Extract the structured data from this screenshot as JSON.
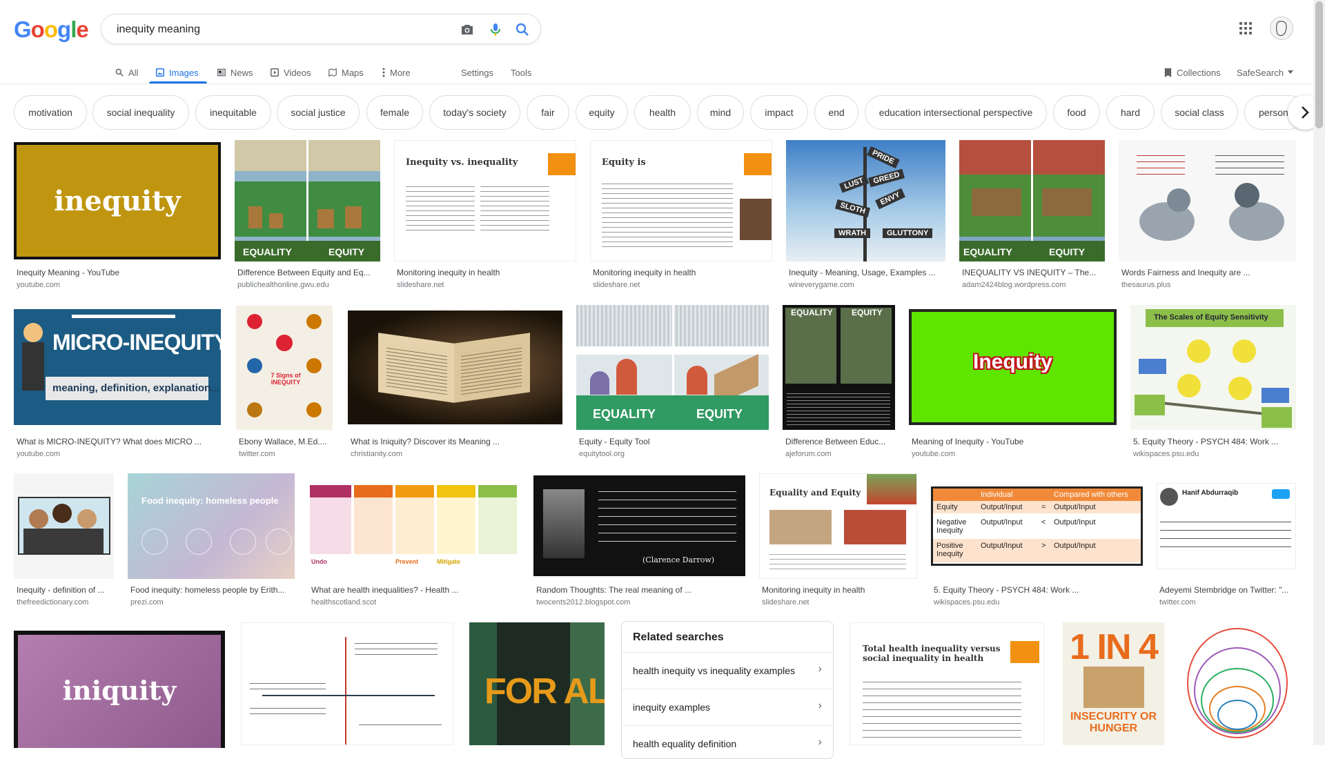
{
  "logo": {
    "letters": [
      "G",
      "o",
      "o",
      "g",
      "l",
      "e"
    ],
    "colors": [
      "#4285f4",
      "#ea4335",
      "#fbbc05",
      "#4285f4",
      "#34a853",
      "#ea4335"
    ]
  },
  "search": {
    "query": "inequity meaning"
  },
  "nav": {
    "all": "All",
    "images": "Images",
    "news": "News",
    "videos": "Videos",
    "maps": "Maps",
    "more": "More",
    "settings": "Settings",
    "tools": "Tools",
    "collections": "Collections",
    "safesearch": "SafeSearch"
  },
  "chips": [
    "motivation",
    "social inequality",
    "inequitable",
    "social justice",
    "female",
    "today's society",
    "fair",
    "equity",
    "health",
    "mind",
    "impact",
    "end",
    "education intersectional perspective",
    "food",
    "hard",
    "social class",
    "person"
  ],
  "results": [
    {
      "title": "Inequity Meaning - YouTube",
      "source": "youtube.com"
    },
    {
      "title": "Difference Between Equity and Eq...",
      "source": "publichealthonline.gwu.edu"
    },
    {
      "title": "Monitoring inequity in health",
      "source": "slideshare.net"
    },
    {
      "title": "Monitoring inequity in health",
      "source": "slideshare.net"
    },
    {
      "title": "Inequity - Meaning, Usage, Examples ...",
      "source": "wineverygame.com"
    },
    {
      "title": "INEQUALITY VS INEQUITY – The...",
      "source": "adam2424blog.wordpress.com"
    },
    {
      "title": "Words Fairness and Inequity are ...",
      "source": "thesaurus.plus"
    },
    {
      "title": "What is MICRO-INEQUITY? What does MICRO ...",
      "source": "youtube.com"
    },
    {
      "title": "Ebony Wallace, M.Ed....",
      "source": "twitter.com"
    },
    {
      "title": "What is Iniquity? Discover its Meaning ...",
      "source": "christianity.com"
    },
    {
      "title": "Equity - Equity Tool",
      "source": "equitytool.org"
    },
    {
      "title": "Difference Between Educ...",
      "source": "ajeforum.com"
    },
    {
      "title": "Meaning of Inequity - YouTube",
      "source": "youtube.com"
    },
    {
      "title": "5. Equity Theory - PSYCH 484: Work ...",
      "source": "wikispaces.psu.edu"
    },
    {
      "title": "Inequity - definition of ...",
      "source": "thefreedictionary.com"
    },
    {
      "title": "Food inequity: homeless people by Erith...",
      "source": "prezi.com"
    },
    {
      "title": "What are health inequalities? - Health ...",
      "source": "healthscotland.scot"
    },
    {
      "title": "Random Thoughts: The real meaning of ...",
      "source": "twocents2012.blogspot.com"
    },
    {
      "title": "Monitoring inequity in health",
      "source": "slideshare.net"
    },
    {
      "title": "5. Equity Theory - PSYCH 484: Work ...",
      "source": "wikispaces.psu.edu"
    },
    {
      "title": "Adeyemi Stembridge on Twitter: \"...",
      "source": "twitter.com"
    }
  ],
  "thumb_text": {
    "inequity": "inequity",
    "equality": "EQUALITY",
    "equity": "EQUITY",
    "ineq_vs": "Inequity vs. inequality",
    "equity_is": "Equity is",
    "micro": "MICRO-INEQUITY",
    "micro_sub": "meaning, definition, explanation...",
    "seven_signs": "7 Signs of INEQUITY",
    "inequity_green": "Inequity",
    "scales": "The Scales of Equity Sensitivity",
    "food_inequity": "Food inequity: homeless people",
    "equality_and_equity": "Equality and Equity",
    "individual": "Individual",
    "compared": "Compared with others",
    "eq_row": [
      "Equity",
      "Output/Input",
      "=",
      "Output/Input"
    ],
    "neg_row": [
      "Negative Inequity",
      "Output/Input",
      "<",
      "Output/Input"
    ],
    "pos_row": [
      "Positive Inequity",
      "Output/Input",
      ">",
      "Output/Input"
    ],
    "hanif": "Hanif Abdurraqib",
    "iniquity": "iniquity",
    "total_health": "Total health inequality versus social inequality in health",
    "one_in_four": "1 IN 4",
    "insecurity": "INSECURITY OR HUNGER",
    "for_all": "FOR ALL",
    "quote": "(Clarence Darrow)",
    "wrath": "WRATH",
    "gluttony": "GLUTTONY",
    "pride": "PRIDE",
    "greed": "GREED",
    "lust": "LUST",
    "envy": "ENVY",
    "sloth": "SLOTH",
    "undo": "Undo",
    "prevent": "Prevent",
    "mitigate": "Mitigate"
  },
  "related": {
    "heading": "Related searches",
    "items": [
      "health inequity vs inequality examples",
      "inequity examples",
      "health equality definition"
    ]
  },
  "colors": {
    "accent": "#1a73e8",
    "chip_border": "#dadce0",
    "muted": "#70757a"
  }
}
